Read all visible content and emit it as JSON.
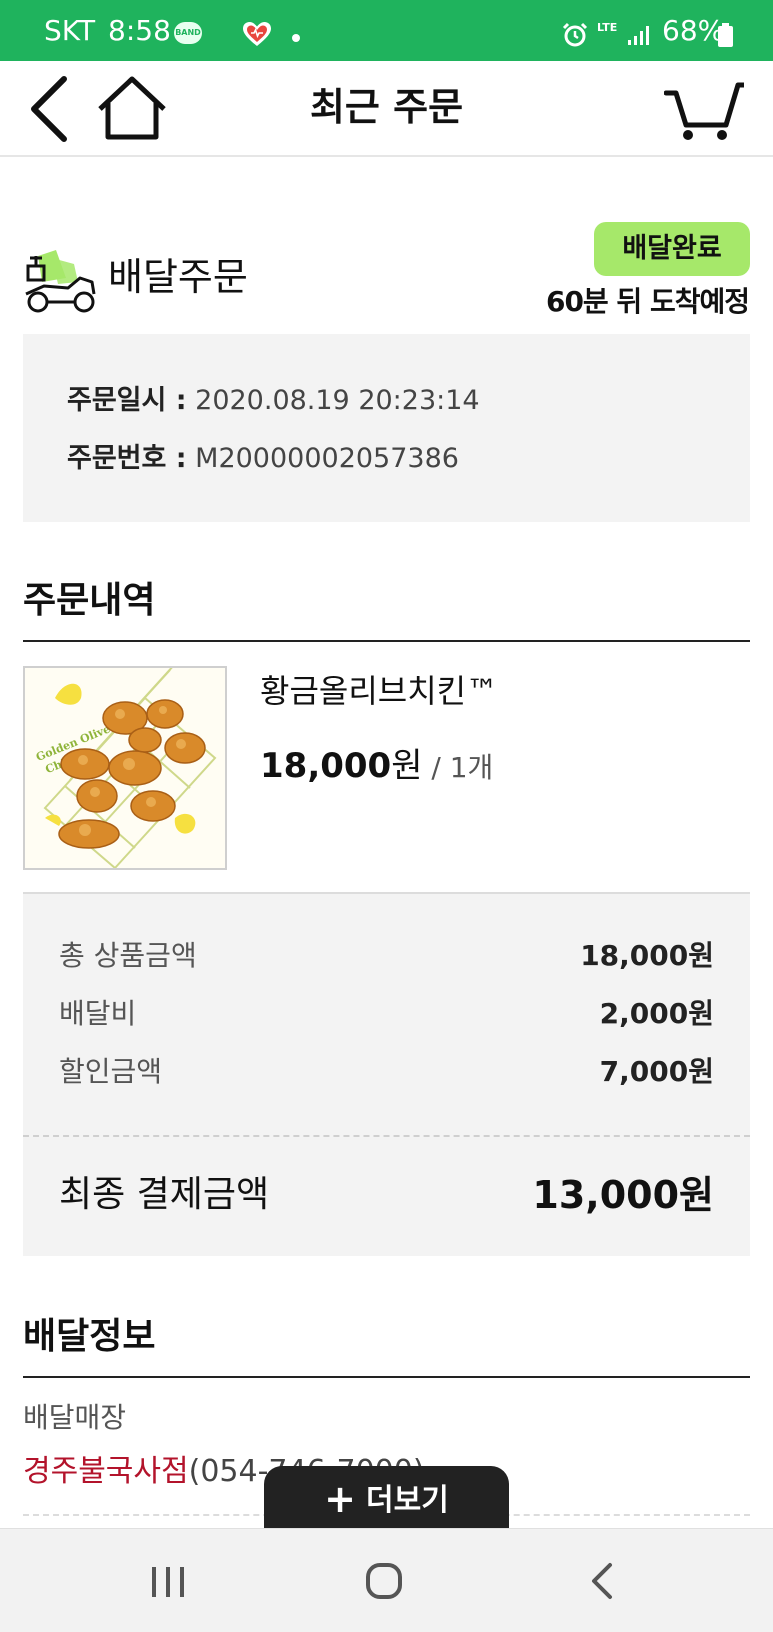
{
  "status_bar": {
    "carrier": "SKT",
    "time": "8:58",
    "band_label": "BAND",
    "network": "LTE",
    "battery": "68%",
    "icons": [
      "band-icon",
      "heart-icon",
      "alarm-icon",
      "lte-icon",
      "signal-icon",
      "battery-icon"
    ]
  },
  "header": {
    "title": "최근 주문",
    "icons": [
      "back-icon",
      "home-icon",
      "cart-icon"
    ]
  },
  "order": {
    "type": "배달주문",
    "status": "배달완료",
    "arrival": "60분 뒤 도착예정",
    "date_label": "주문일시 :",
    "date_value": " 2020.08.19 20:23:14",
    "number_label": "주문번호 :",
    "number_value": " M20000002057386"
  },
  "items_section": {
    "title": "주문내역",
    "items": [
      {
        "name": "황금올리브치킨™",
        "price": "18,000",
        "currency": "원",
        "qty": " / 1개",
        "image_text": "Golden Olive Chicken"
      }
    ]
  },
  "summary": {
    "rows": [
      {
        "label": "총 상품금액",
        "value": "18,000원"
      },
      {
        "label": "배달비",
        "value": "2,000원"
      },
      {
        "label": "할인금액",
        "value": "7,000원"
      }
    ],
    "final_label": "최종 결제금액",
    "final_value": "13,000원"
  },
  "delivery_section": {
    "title": "배달정보",
    "store_label": "배달매장",
    "store_name": "경주불국사점",
    "store_phone": "(054-746-7000)"
  },
  "more_button": {
    "label": "더보기"
  },
  "nav_bar": {
    "icons": [
      "recent-apps-icon",
      "home-circle-icon",
      "back-arrow-icon"
    ]
  },
  "colors": {
    "status_bar": "#1fb35d",
    "badge": "#a6e86a",
    "store_name": "#b3132b",
    "panel": "#f3f3f3"
  }
}
